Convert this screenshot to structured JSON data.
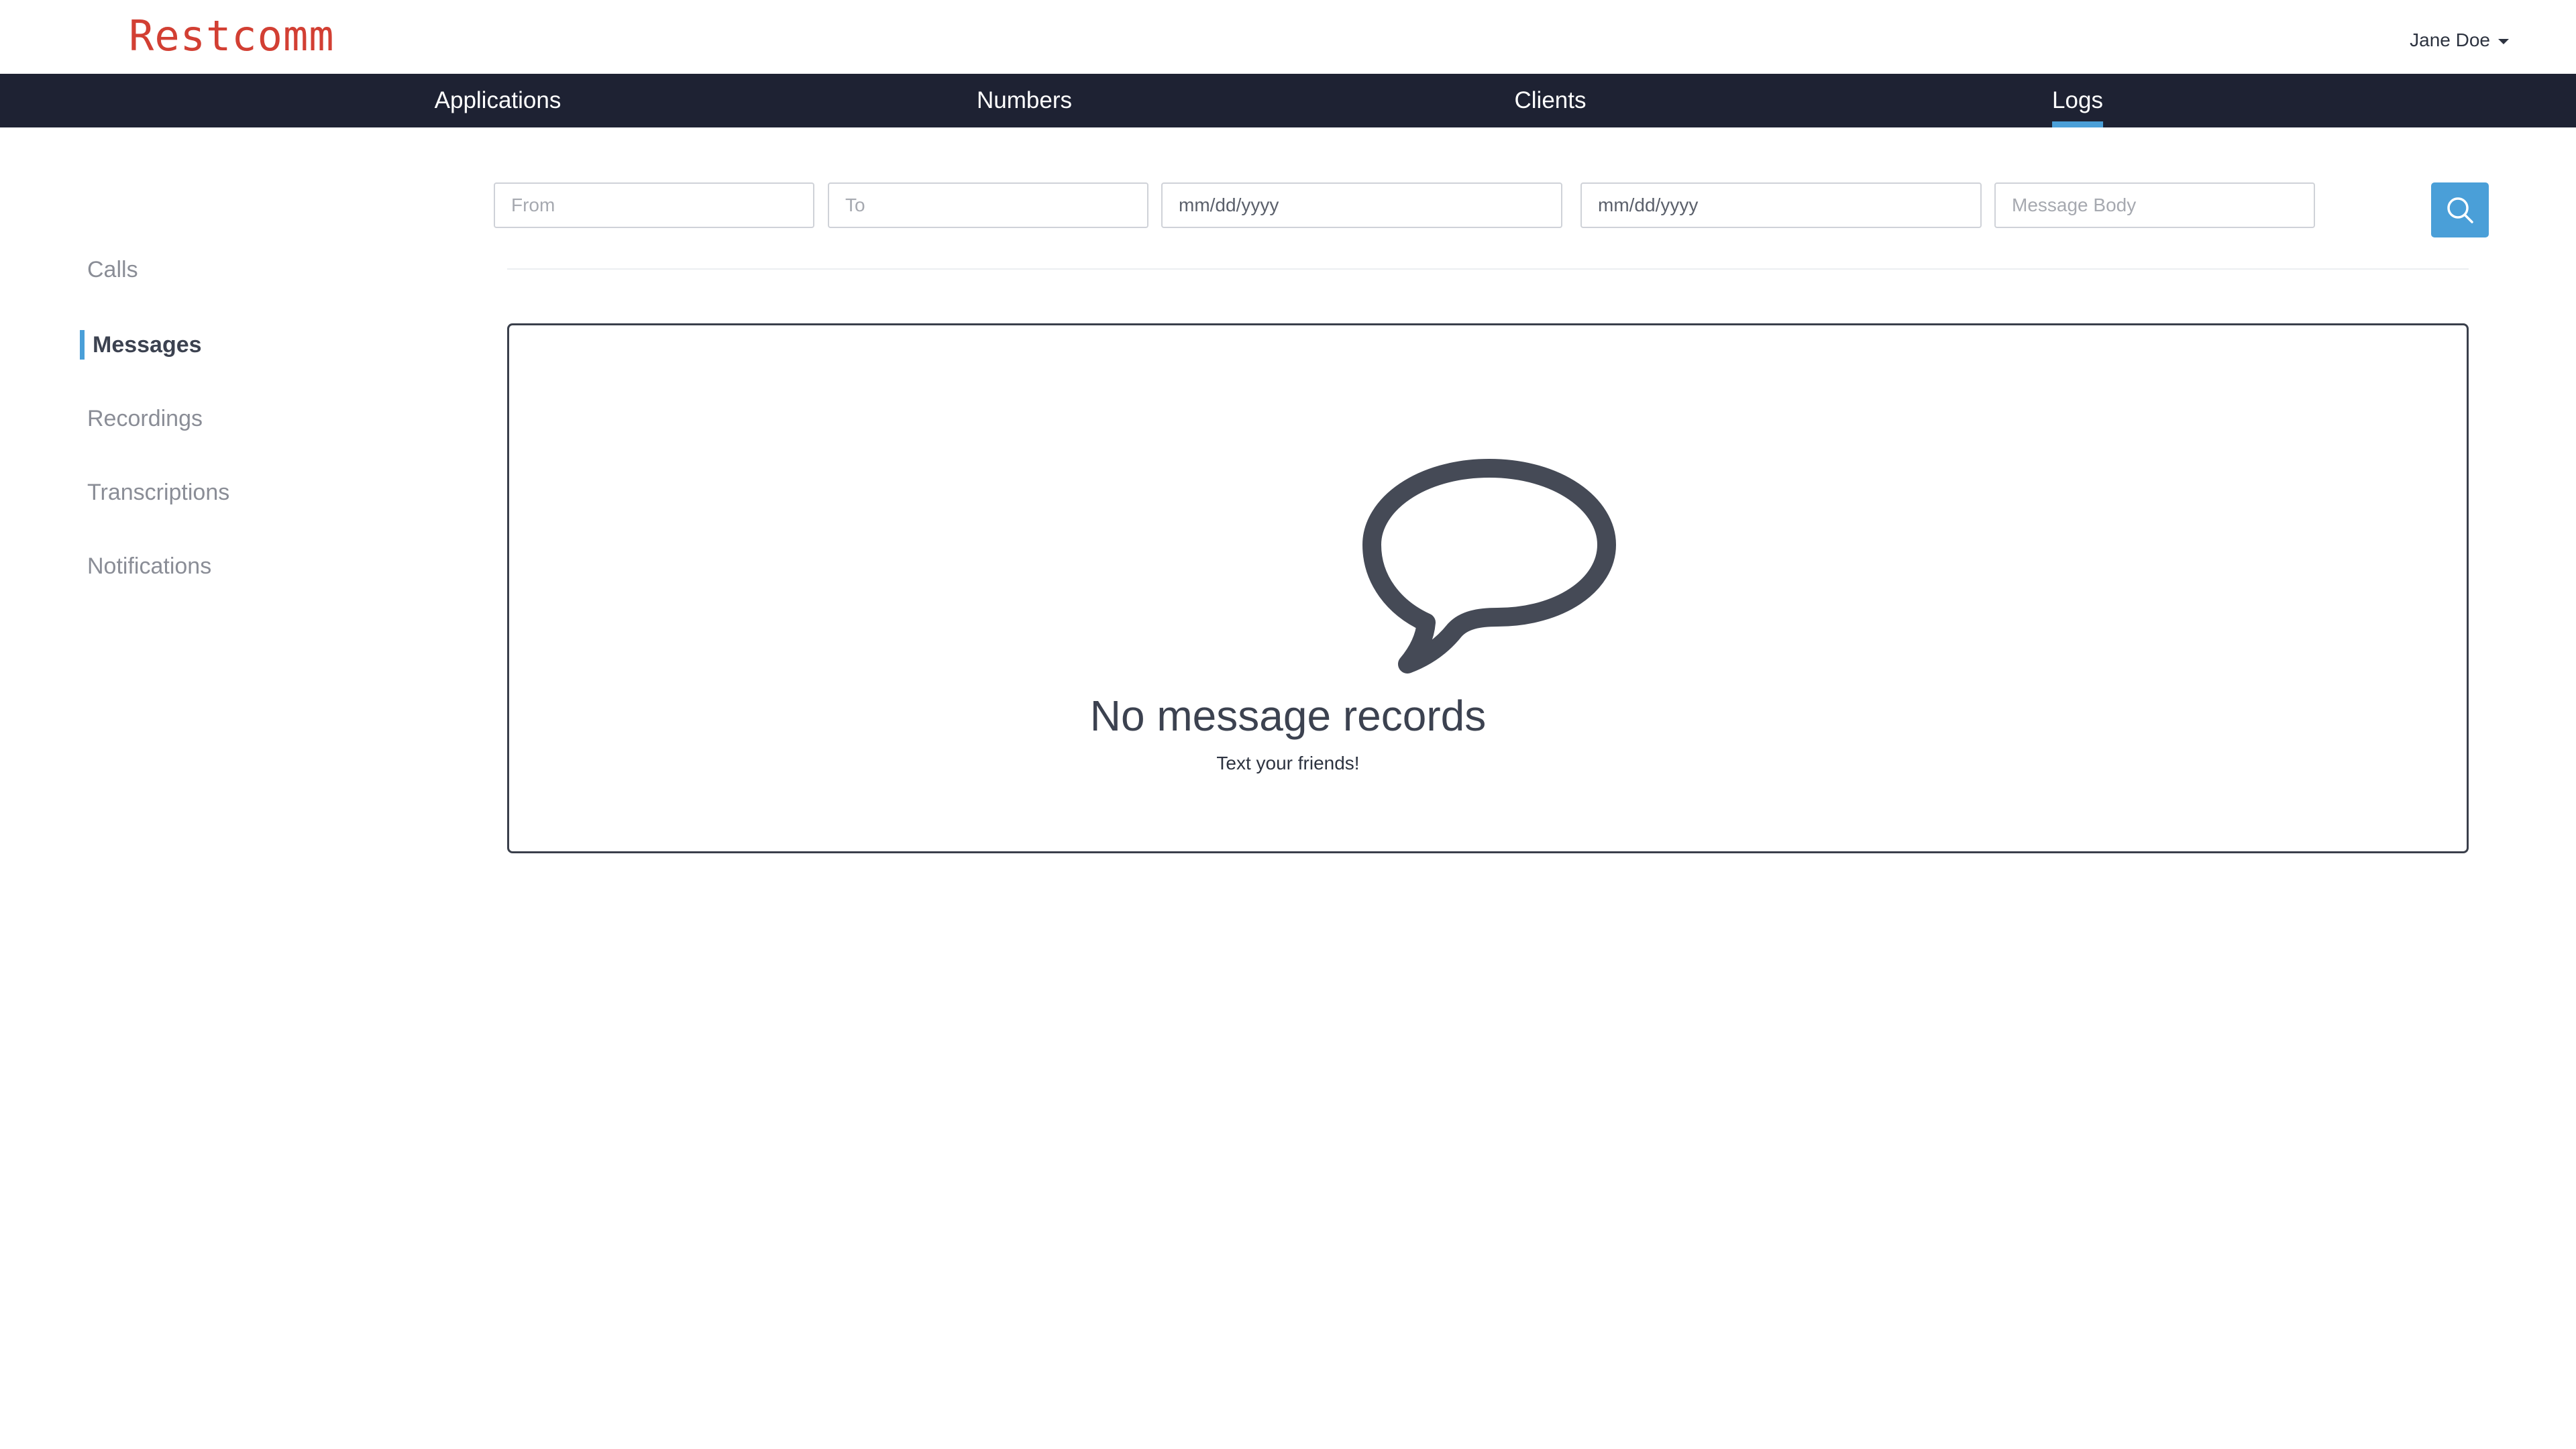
{
  "header": {
    "logo_text": "Restcomm",
    "user_name": "Jane Doe",
    "brand_color": "#d23f33"
  },
  "nav": {
    "items": [
      {
        "label": "Applications",
        "active": false
      },
      {
        "label": "Numbers",
        "active": false
      },
      {
        "label": "Clients",
        "active": false
      },
      {
        "label": "Logs",
        "active": true
      }
    ],
    "background_color": "#1e2233",
    "accent_color": "#4a9fd8"
  },
  "sidebar": {
    "items": [
      {
        "label": "Calls",
        "active": false
      },
      {
        "label": "Messages",
        "active": true
      },
      {
        "label": "Recordings",
        "active": false
      },
      {
        "label": "Transcriptions",
        "active": false
      },
      {
        "label": "Notifications",
        "active": false
      }
    ]
  },
  "filters": {
    "from_placeholder": "From",
    "to_placeholder": "To",
    "start_date_placeholder": "mm/dd/yyyy",
    "end_date_placeholder": "mm/dd/yyyy",
    "body_placeholder": "Message Body",
    "search_icon": "search-icon"
  },
  "empty_state": {
    "icon": "speech-bubble-icon",
    "title": "No message records",
    "subtitle": "Text your friends!"
  }
}
